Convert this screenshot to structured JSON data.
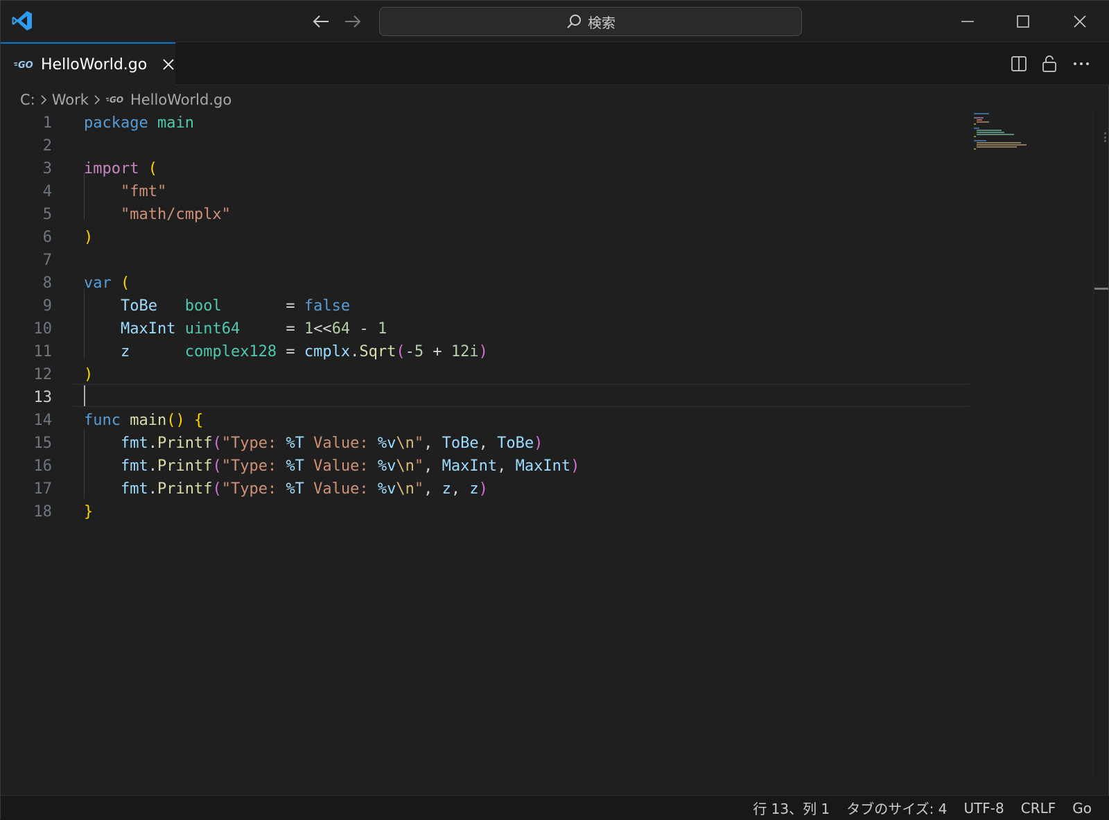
{
  "titlebar": {
    "search_text": "検索"
  },
  "tab": {
    "label": "HelloWorld.go",
    "icon": "go-file-icon"
  },
  "breadcrumb": {
    "parts": [
      "C:",
      "Work",
      "HelloWorld.go"
    ]
  },
  "editor": {
    "language": "Go",
    "active_line": 13,
    "line_numbers": [
      "1",
      "2",
      "3",
      "4",
      "5",
      "6",
      "7",
      "8",
      "9",
      "10",
      "11",
      "12",
      "13",
      "14",
      "15",
      "16",
      "17",
      "18"
    ],
    "lines": [
      "package main",
      "",
      "import (",
      "    \"fmt\"",
      "    \"math/cmplx\"",
      ")",
      "",
      "var (",
      "    ToBe   bool       = false",
      "    MaxInt uint64     = 1<<64 - 1",
      "    z      complex128 = cmplx.Sqrt(-5 + 12i)",
      ")",
      "",
      "func main() {",
      "    fmt.Printf(\"Type: %T Value: %v\\n\", ToBe, ToBe)",
      "    fmt.Printf(\"Type: %T Value: %v\\n\", MaxInt, MaxInt)",
      "    fmt.Printf(\"Type: %T Value: %v\\n\", z, z)",
      "}"
    ]
  },
  "statusbar": {
    "position": "行 13、列 1",
    "tab_size": "タブのサイズ: 4",
    "encoding": "UTF-8",
    "eol": "CRLF",
    "language": "Go"
  },
  "colors": {
    "accent": "#0078d4",
    "background": "#1f1f1f"
  }
}
